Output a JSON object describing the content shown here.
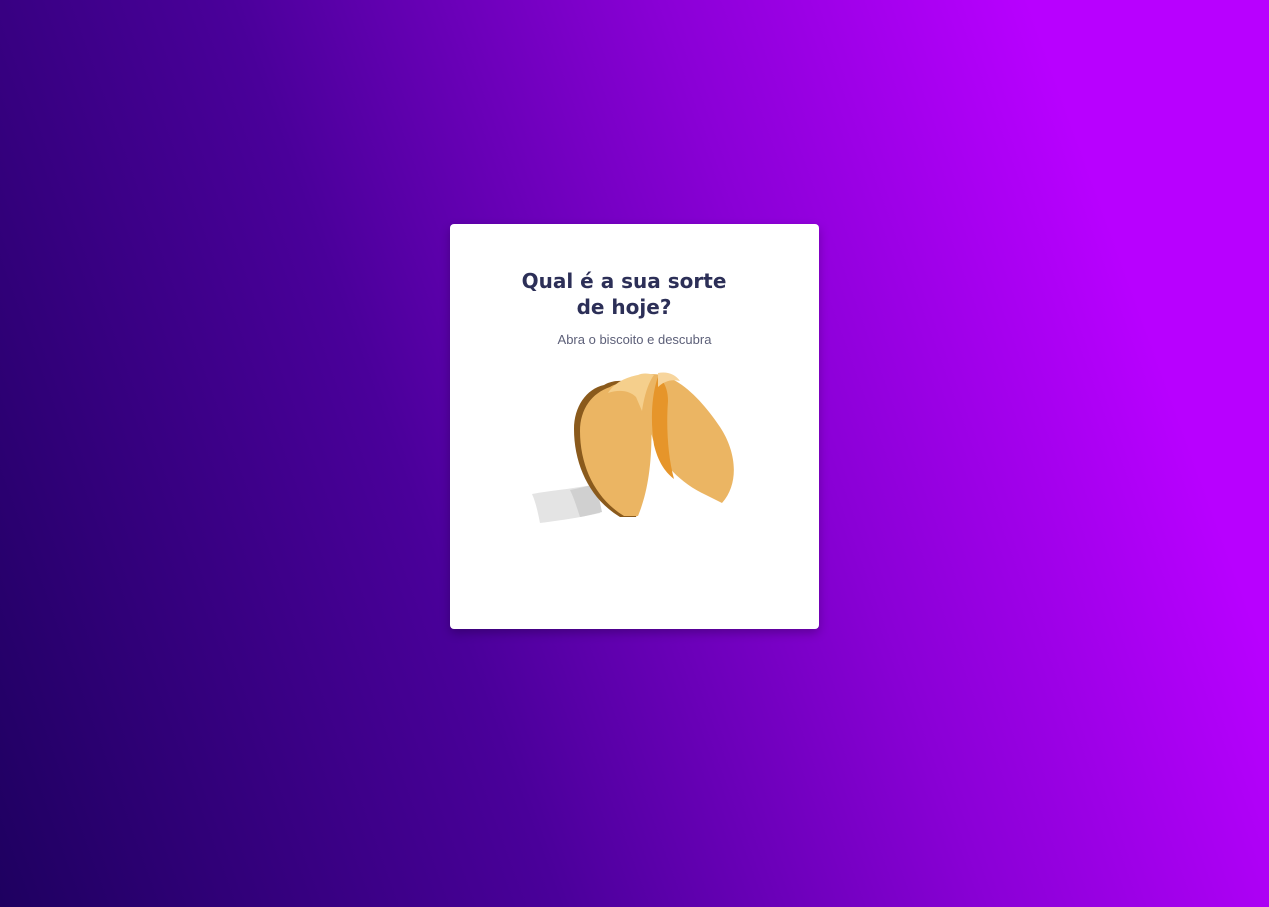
{
  "colors": {
    "background_gradient_start": "#1e0060",
    "background_gradient_end": "#b800ff",
    "card_background": "#ffffff",
    "title_color": "#2c2f57",
    "subtitle_color": "#5c5f78",
    "cookie_color": "#ebb563",
    "cookie_shadow": "#8a5a1c",
    "cookie_fold": "#e6952a",
    "paper_color": "#e4e4e4"
  },
  "card": {
    "title_line1": "Qual é a sua sorte",
    "title_line2": "de hoje?",
    "subtitle": "Abra o biscoito e descubra",
    "cookie_icon": "fortune-cookie-icon"
  }
}
